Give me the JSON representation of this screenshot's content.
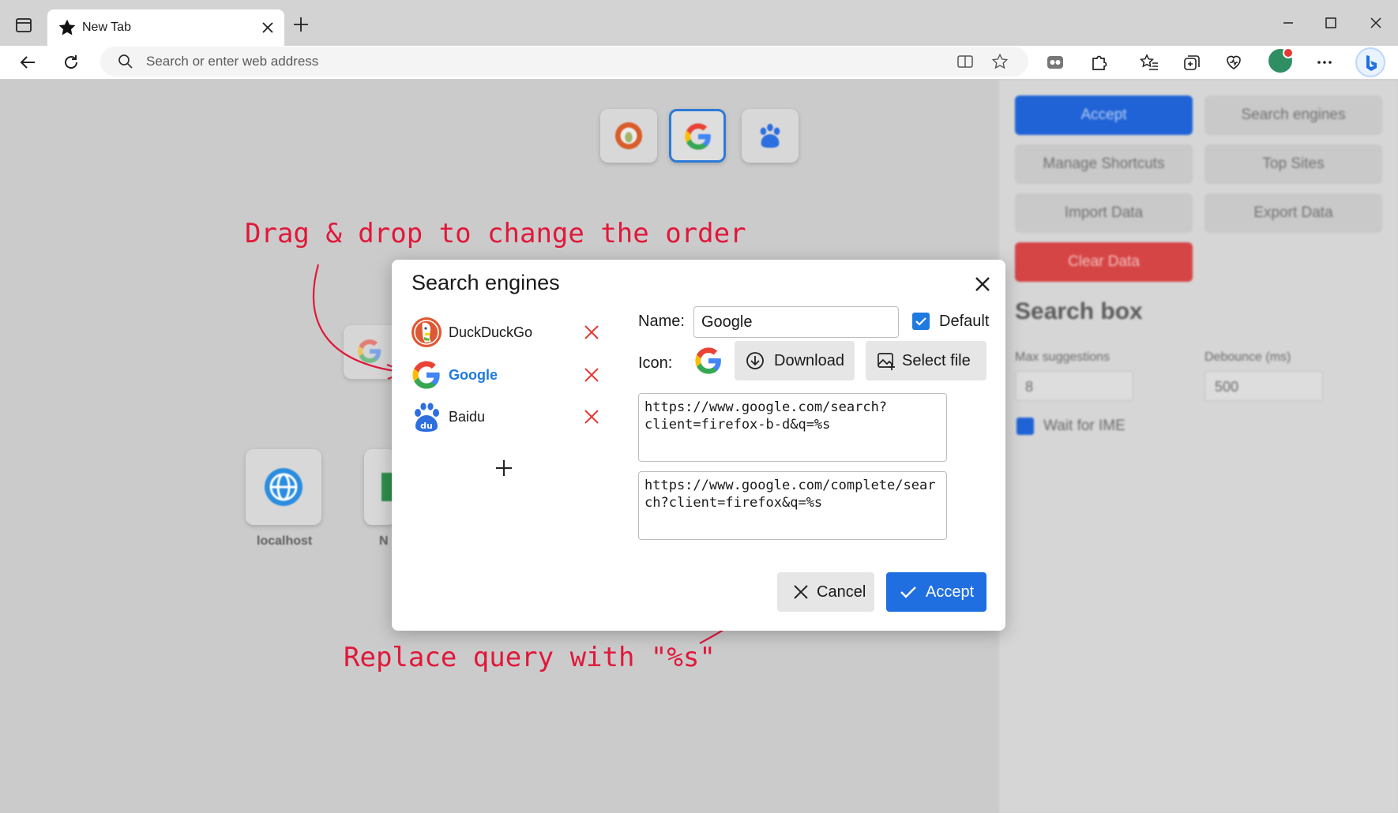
{
  "browser": {
    "tab_title": "New Tab",
    "address_placeholder": "Search or enter web address"
  },
  "side_panel": {
    "buttons": {
      "accept": "Accept",
      "search_engines": "Search engines",
      "manage_shortcuts": "Manage Shortcuts",
      "top_sites": "Top Sites",
      "import_data": "Import Data",
      "export_data": "Export Data",
      "clear_data": "Clear Data"
    },
    "heading": "Search box",
    "max_suggestions_label": "Max suggestions",
    "max_suggestions_value": "8",
    "debounce_label": "Debounce (ms)",
    "debounce_value": "500",
    "wait_for_ime_label": "Wait for IME",
    "wait_for_ime_checked": true
  },
  "shortcuts": [
    {
      "label": "localhost"
    },
    {
      "label": "N"
    }
  ],
  "annotations": {
    "drag_hint": "Drag & drop to change the order",
    "replace_hint": "Replace query with \"%s\""
  },
  "dialog": {
    "title": "Search engines",
    "engines": [
      {
        "name": "DuckDuckGo",
        "icon": "duckduckgo-icon",
        "selected": false
      },
      {
        "name": "Google",
        "icon": "google-icon",
        "selected": true
      },
      {
        "name": "Baidu",
        "icon": "baidu-icon",
        "selected": false
      }
    ],
    "name_label": "Name:",
    "name_value": "Google",
    "default_label": "Default",
    "default_checked": true,
    "icon_label": "Icon:",
    "download_label": "Download",
    "select_file_label": "Select file",
    "search_url": "https://www.google.com/search?client=firefox-b-d&q=%s",
    "suggest_url": "https://www.google.com/complete/search?client=firefox&q=%s",
    "cancel_label": "Cancel",
    "accept_label": "Accept"
  },
  "colors": {
    "accent": "#1f6fe0",
    "delete": "#e53935",
    "annotation": "#e0183a"
  }
}
